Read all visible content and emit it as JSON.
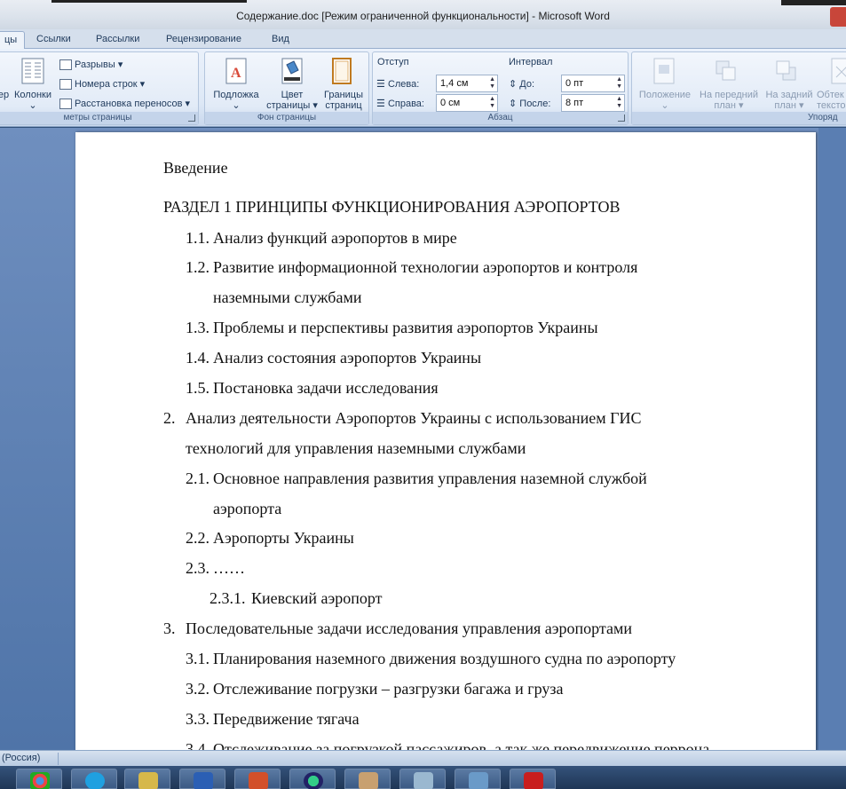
{
  "window": {
    "title": "Содержание.doc [Режим ограниченной функциональности] - Microsoft Word"
  },
  "tabs": [
    "цы",
    "Ссылки",
    "Рассылки",
    "Рецензирование",
    "Вид"
  ],
  "ribbon": {
    "page_setup": {
      "label": "метры страницы",
      "btn_partial": "ер",
      "columns": "Колонки",
      "breaks": "Разрывы",
      "line_numbers": "Номера строк",
      "hyphenation": "Расстановка переносов"
    },
    "page_background": {
      "label": "Фон страницы",
      "watermark": "Подложка",
      "page_color_1": "Цвет",
      "page_color_2": "страницы",
      "page_borders_1": "Границы",
      "page_borders_2": "страниц"
    },
    "paragraph": {
      "label": "Абзац",
      "indent_title": "Отступ",
      "left_label": "Слева:",
      "left_value": "1,4 см",
      "right_label": "Справа:",
      "right_value": "0 см",
      "spacing_title": "Интервал",
      "before_label": "До:",
      "before_value": "0 пт",
      "after_label": "После:",
      "after_value": "8 пт"
    },
    "arrange": {
      "label": "Упоряд",
      "position": "Положение",
      "front_1": "На передний",
      "front_2": "план",
      "back_1": "На задний",
      "back_2": "план",
      "wrap_1": "Обтек",
      "wrap_2": "тексто"
    }
  },
  "document": {
    "lines": [
      {
        "text": "Введение"
      },
      {
        "text": "РАЗДЕЛ 1 ПРИНЦИПЫ ФУНКЦИОНИРОВАНИЯ  АЭРОПОРТОВ"
      },
      {
        "num": "1.1.",
        "text": "Анализ функций аэропортов в мире"
      },
      {
        "num": "1.2.",
        "text": "Развитие информационной технологии аэропортов и контроля"
      },
      {
        "text": "наземными службами"
      },
      {
        "num": "1.3.",
        "text": "Проблемы и перспективы развития аэропортов Украины"
      },
      {
        "num": "1.4.",
        "text": "Анализ состояния аэропортов Украины"
      },
      {
        "num": "1.5.",
        "text": "Постановка задачи исследования"
      },
      {
        "num": "2.",
        "text": "Анализ деятельности Аэропортов Украины с использованием ГИС"
      },
      {
        "text": "технологий для управления наземными службами"
      },
      {
        "num": "2.1.",
        "text": "Основное направления развития управления наземной службой"
      },
      {
        "text": "аэропорта"
      },
      {
        "num": "2.2.",
        "text": "Аэропорты Украины"
      },
      {
        "num": "2.3.",
        "text": "……"
      },
      {
        "num": "2.3.1.",
        "text": "Киевский аэропорт"
      },
      {
        "num": "3.",
        "text": "Последовательные задачи исследования управления аэропортами"
      },
      {
        "num": "3.1.",
        "text": "Планирования наземного движения воздушного судна по аэропорту"
      },
      {
        "num": "3.2.",
        "text": "Отслеживание погрузки – разгрузки багажа и груза"
      },
      {
        "num": "3.3.",
        "text": "Передвижение тягача"
      },
      {
        "num": "3.4.",
        "text": "Отслеживание за погрузкой пассажиров, а так же передвижение перрона"
      }
    ]
  },
  "statusbar": {
    "language": "(Россия)"
  },
  "taskbar": {
    "apps": [
      "chrome-icon",
      "skype-icon",
      "folder-icon",
      "word-icon",
      "powerpoint-icon",
      "globe-icon",
      "paint-icon",
      "eraser-icon",
      "photo-icon",
      "pdf-icon"
    ]
  }
}
